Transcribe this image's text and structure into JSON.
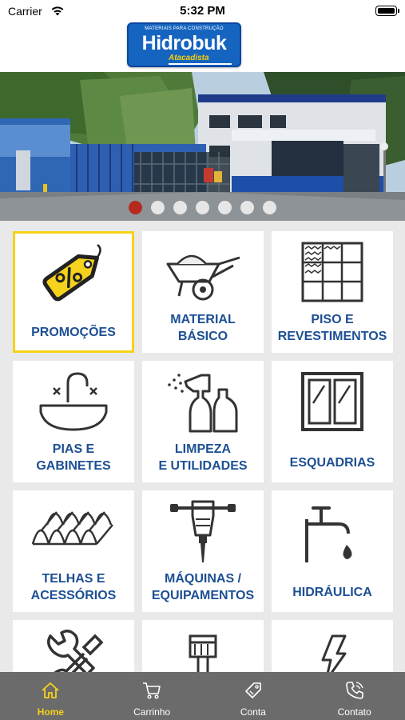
{
  "status_bar": {
    "carrier": "Carrier",
    "time": "5:32 PM"
  },
  "logo": {
    "tagline": "MATERIAIS PARA CONSTRUÇÃO",
    "name": "Hidrobuk",
    "subtitle": "Atacadista"
  },
  "banner": {
    "slide_count": 7,
    "active_slide": 0
  },
  "categories": [
    {
      "line1": "PROMOÇÕES",
      "line2": "",
      "icon": "percent-tag-icon"
    },
    {
      "line1": "MATERIAL",
      "line2": "BÁSICO",
      "icon": "wheelbarrow-icon"
    },
    {
      "line1": "PISO E",
      "line2": "REVESTIMENTOS",
      "icon": "tiles-icon"
    },
    {
      "line1": "PIAS E",
      "line2": "GABINETES",
      "icon": "sink-icon"
    },
    {
      "line1": "LIMPEZA",
      "line2": "E UTILIDADES",
      "icon": "spray-bottle-icon"
    },
    {
      "line1": "ESQUADRIAS",
      "line2": "",
      "icon": "window-icon"
    },
    {
      "line1": "TELHAS E",
      "line2": "ACESSÓRIOS",
      "icon": "roof-tile-icon"
    },
    {
      "line1": "MÁQUINAS /",
      "line2": "EQUIPAMENTOS",
      "icon": "jackhammer-icon"
    },
    {
      "line1": "HIDRÁULICA",
      "line2": "",
      "icon": "faucet-icon"
    },
    {
      "line1": "",
      "line2": "",
      "icon": "wrench-icon"
    },
    {
      "line1": "",
      "line2": "",
      "icon": "paint-brush-icon"
    },
    {
      "line1": "",
      "line2": "",
      "icon": "lightning-icon"
    }
  ],
  "tabs": [
    {
      "label": "Home",
      "icon": "home-icon",
      "active": true
    },
    {
      "label": "Carrinho",
      "icon": "cart-icon",
      "active": false
    },
    {
      "label": "Conta",
      "icon": "tag-icon",
      "active": false
    },
    {
      "label": "Contato",
      "icon": "phone-icon",
      "active": false
    }
  ],
  "colors": {
    "accent": "#f5d21b",
    "label_blue": "#1d4f93",
    "tabbar": "#6b6b6b",
    "active_dot": "#b52a1e"
  }
}
